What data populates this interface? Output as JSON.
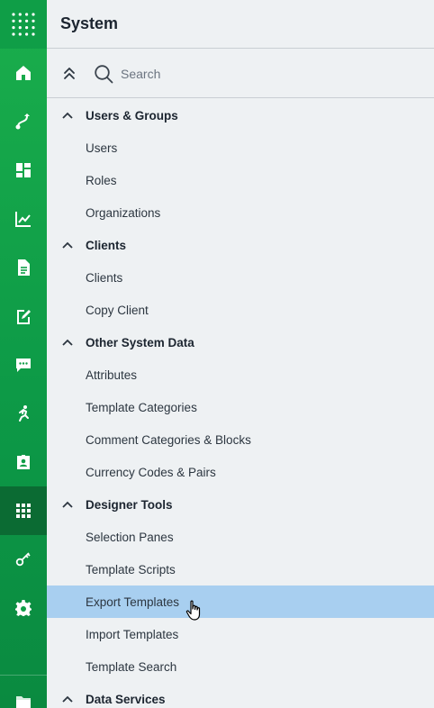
{
  "header": {
    "title": "System"
  },
  "search": {
    "placeholder": "Search"
  },
  "rail": {
    "items": [
      {
        "icon": "home-icon",
        "active": false
      },
      {
        "icon": "route-icon",
        "active": false
      },
      {
        "icon": "dashboard-icon",
        "active": false
      },
      {
        "icon": "analytics-icon",
        "active": false
      },
      {
        "icon": "document-icon",
        "active": false
      },
      {
        "icon": "edit-document-icon",
        "active": false
      },
      {
        "icon": "chat-icon",
        "active": false
      },
      {
        "icon": "running-person-icon",
        "active": false
      },
      {
        "icon": "contact-card-icon",
        "active": false
      },
      {
        "icon": "apps-grid-icon",
        "active": true
      },
      {
        "icon": "key-icon",
        "active": false
      },
      {
        "icon": "gear-icon",
        "active": false
      },
      {
        "icon": "folder-icon",
        "active": false
      }
    ]
  },
  "tree": {
    "rows": [
      {
        "type": "group",
        "label": "Users & Groups"
      },
      {
        "type": "leaf",
        "label": "Users"
      },
      {
        "type": "leaf",
        "label": "Roles"
      },
      {
        "type": "leaf",
        "label": "Organizations"
      },
      {
        "type": "group",
        "label": "Clients"
      },
      {
        "type": "leaf",
        "label": "Clients"
      },
      {
        "type": "leaf",
        "label": "Copy Client"
      },
      {
        "type": "group",
        "label": "Other System Data"
      },
      {
        "type": "leaf",
        "label": "Attributes"
      },
      {
        "type": "leaf",
        "label": "Template Categories"
      },
      {
        "type": "leaf",
        "label": "Comment Categories & Blocks"
      },
      {
        "type": "leaf",
        "label": "Currency Codes & Pairs"
      },
      {
        "type": "group",
        "label": "Designer Tools"
      },
      {
        "type": "leaf",
        "label": "Selection Panes"
      },
      {
        "type": "leaf",
        "label": "Template Scripts"
      },
      {
        "type": "leaf",
        "label": "Export Templates",
        "selected": true
      },
      {
        "type": "leaf",
        "label": "Import Templates"
      },
      {
        "type": "leaf",
        "label": "Template Search"
      },
      {
        "type": "group",
        "label": "Data Services"
      }
    ]
  },
  "colors": {
    "rail_green": "#0f9e47",
    "rail_active": "#0b6b33",
    "selected_row": "#a8cff0",
    "panel_bg": "#eef1f3"
  }
}
